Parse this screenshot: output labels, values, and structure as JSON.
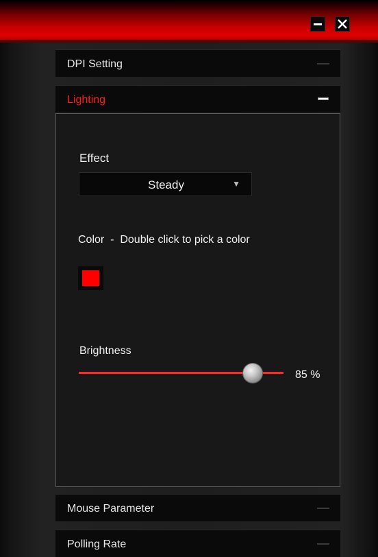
{
  "window": {
    "minimize_icon": "minimize-icon",
    "close_icon": "close-icon"
  },
  "sections": {
    "dpi": {
      "label": "DPI Setting"
    },
    "lighting": {
      "label": "Lighting"
    },
    "mouse": {
      "label": "Mouse Parameter"
    },
    "polling": {
      "label": "Polling Rate"
    }
  },
  "lighting": {
    "effect_label": "Effect",
    "effect_value": "Steady",
    "color_label": "Color  -  Double click to pick a color",
    "color_value": "#ff0000",
    "brightness_label": "Brightness",
    "brightness_value": "85 %",
    "brightness_percent": 85
  },
  "colors": {
    "accent": "#ff1a1a",
    "titlebar": "#d40000"
  }
}
